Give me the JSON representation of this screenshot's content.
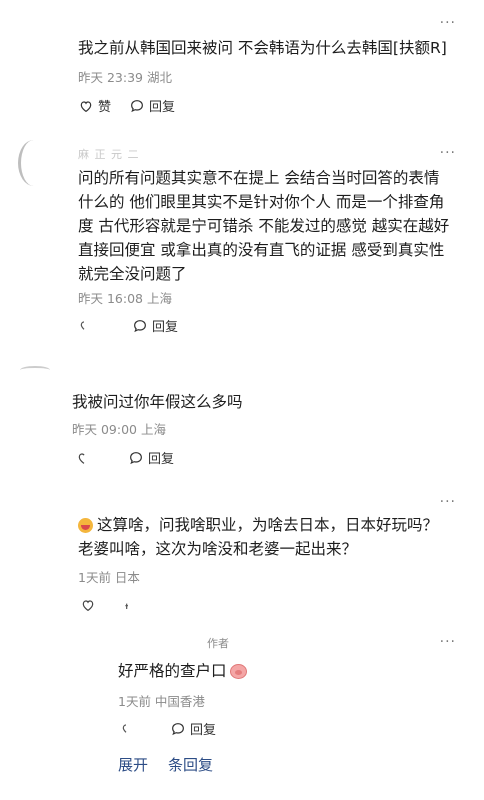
{
  "comments": [
    {
      "text": "我之前从韩国回来被问 不会韩语为什么去韩国[扶额R]",
      "meta": "昨天 23:39 湖北",
      "like_label": "赞",
      "reply_label": "回复"
    },
    {
      "username_partial": "麻 正 元 二",
      "text_lines": [
        "问的所有问题其实意不在提上 会结合当时回答的表情",
        "什么的 他们眼里其实不是针对你个人 而是一个排查角",
        "度 古代形容就是宁可错杀 不能发过的感觉 越实在越好",
        "直接回便宜 或拿出真的没有直飞的证据 感受到真实性",
        "就完全没问题了"
      ],
      "meta": "昨天 16:08 上海",
      "reply_label": "回复"
    },
    {
      "text": "我被问过你年假这么多吗",
      "meta": "昨天 09:00 上海",
      "reply_label": "回复"
    },
    {
      "text_lines": [
        "这算啥，问我啥职业，为啥去日本，日本好玩吗？",
        "老婆叫啥，这次为啥没和老婆一起出来？"
      ],
      "meta": "1天前 日本"
    }
  ],
  "reply": {
    "author_tag": "作者",
    "text": "好严格的查户口",
    "meta": "1天前 中国香港",
    "reply_label": "回复"
  },
  "footer": {
    "expand_label": "展开",
    "count_label": "条回复"
  },
  "more_glyph": "···",
  "colors": {
    "text": "#1d1d1d",
    "meta": "#8b8b8b",
    "link": "#2d4d86"
  }
}
